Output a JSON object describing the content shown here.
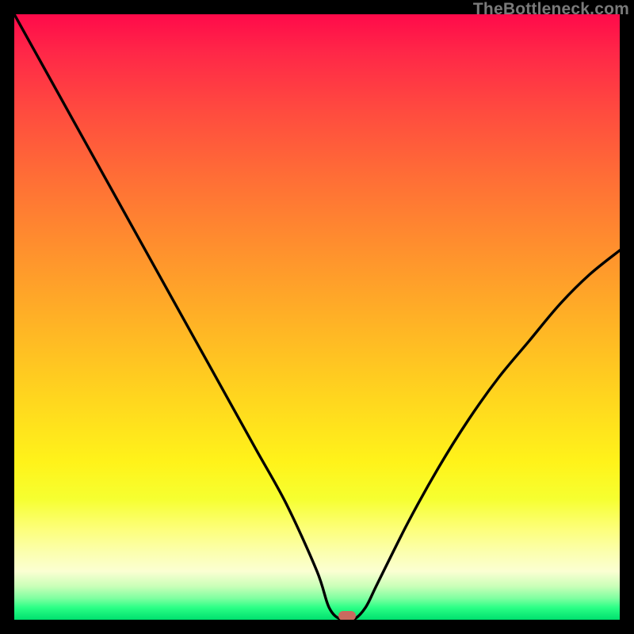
{
  "attribution": "TheBottleneck.com",
  "colors": {
    "frame": "#000000",
    "gradient_top": "#ff0a4a",
    "gradient_bottom": "#00e06e",
    "curve": "#000000",
    "marker": "#c96a5f"
  },
  "chart_data": {
    "type": "line",
    "title": "",
    "xlabel": "",
    "ylabel": "",
    "xlim": [
      0,
      100
    ],
    "ylim": [
      0,
      100
    ],
    "x": [
      0,
      5,
      10,
      15,
      20,
      25,
      30,
      35,
      40,
      45,
      50,
      52,
      54,
      56,
      58,
      60,
      65,
      70,
      75,
      80,
      85,
      90,
      95,
      100
    ],
    "values": [
      100,
      91,
      82,
      73,
      64,
      55,
      46,
      37,
      28,
      19,
      8,
      2,
      0,
      0,
      2,
      6,
      16,
      25,
      33,
      40,
      46,
      52,
      57,
      61
    ],
    "grid": false,
    "legend": false,
    "annotations": {
      "marker_x": 55,
      "marker_y": 0
    }
  }
}
